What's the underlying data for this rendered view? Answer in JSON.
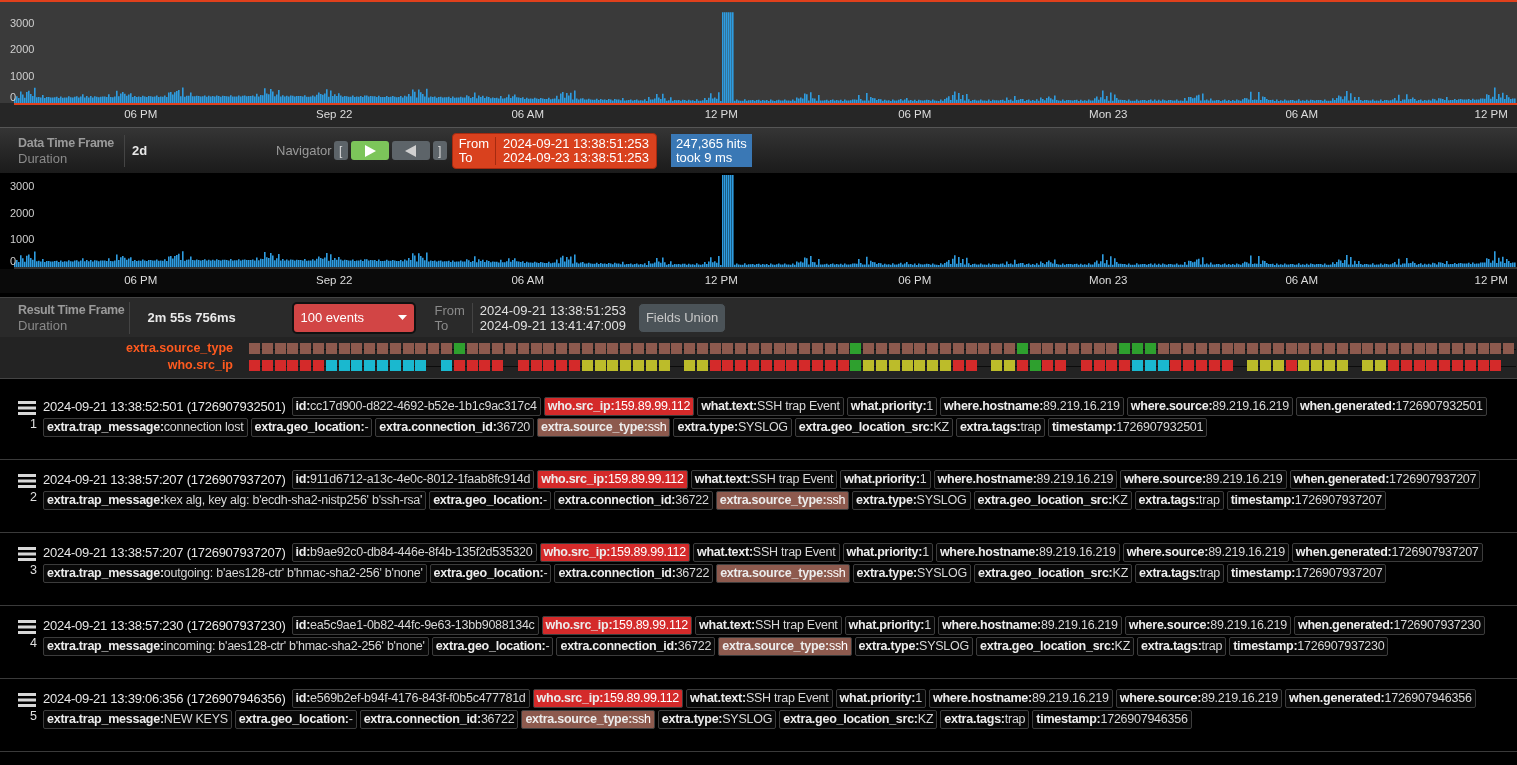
{
  "histograms": [
    {
      "kind": "overview",
      "y_labels": [
        "3000",
        "2000",
        "1000",
        "0"
      ],
      "x_labels": [
        "06 PM",
        "Sep 22",
        "06 AM",
        "12 PM",
        "06 PM",
        "Mon 23",
        "06 AM",
        "12 PM"
      ]
    },
    {
      "kind": "detail",
      "y_labels": [
        "3000",
        "2000",
        "1000",
        "0"
      ],
      "x_labels": [
        "06 PM",
        "Sep 22",
        "06 AM",
        "12 PM",
        "06 PM",
        "Mon 23",
        "06 AM",
        "12 PM"
      ]
    }
  ],
  "data_toolbar": {
    "title": "Data Time Frame",
    "subtitle": "Duration",
    "duration": "2d",
    "navigator": {
      "label": "Navigator",
      "open_bracket": "[",
      "close_bracket": "]"
    },
    "range": {
      "from_label": "From",
      "to_label": "To",
      "from": "2024-09-21 13:38:51:253",
      "to": "2024-09-23 13:38:51:253"
    },
    "hits": {
      "count": "247,365 hits",
      "took": "took 9 ms"
    }
  },
  "result_toolbar": {
    "title": "Result Time Frame",
    "subtitle": "Duration",
    "duration": "2m 55s 756ms",
    "events_dropdown": "100 events",
    "from_label": "From",
    "to_label": "To",
    "from": "2024-09-21 13:38:51:253",
    "to": "2024-09-21 13:41:47:009",
    "fields_union": "Fields Union"
  },
  "timeline": [
    {
      "label": "extra.source_type",
      "cells": [
        {
          "kind": "cell",
          "color": "#8d5a4e"
        },
        {
          "kind": "cell",
          "color": "#8d5a4e"
        },
        {
          "kind": "cell",
          "color": "#8d5a4e"
        },
        {
          "kind": "cell",
          "color": "#8d5a4e"
        },
        {
          "kind": "cell",
          "color": "#8d5a4e"
        },
        {
          "kind": "cell",
          "color": "#8d5a4e"
        },
        {
          "kind": "cell",
          "color": "#8d5a4e"
        },
        {
          "kind": "cell",
          "color": "#8d5a4e"
        },
        {
          "kind": "cell",
          "color": "#8d5a4e"
        },
        {
          "kind": "cell",
          "color": "#8d5a4e"
        },
        {
          "kind": "cell",
          "color": "#8d5a4e"
        },
        {
          "kind": "cell",
          "color": "#8d5a4e"
        },
        {
          "kind": "cell",
          "color": "#8d5a4e"
        },
        {
          "kind": "cell",
          "color": "#8d5a4e"
        },
        {
          "kind": "cell",
          "color": "#8d5a4e"
        },
        {
          "kind": "cell",
          "color": "#8d5a4e"
        },
        {
          "kind": "cell",
          "color": "#2ea02e"
        },
        {
          "kind": "cell",
          "color": "#8d5a4e"
        },
        {
          "kind": "cell",
          "color": "#8d5a4e"
        },
        {
          "kind": "cell",
          "color": "#8d5a4e"
        },
        {
          "kind": "cell",
          "color": "#8d5a4e"
        },
        {
          "kind": "cell",
          "color": "#8d5a4e"
        },
        {
          "kind": "cell",
          "color": "#8d5a4e"
        },
        {
          "kind": "cell",
          "color": "#8d5a4e"
        },
        {
          "kind": "cell",
          "color": "#8d5a4e"
        },
        {
          "kind": "cell",
          "color": "#8d5a4e"
        },
        {
          "kind": "cell",
          "color": "#8d5a4e"
        },
        {
          "kind": "cell",
          "color": "#8d5a4e"
        },
        {
          "kind": "cell",
          "color": "#8d5a4e"
        },
        {
          "kind": "cell",
          "color": "#8d5a4e"
        },
        {
          "kind": "cell",
          "color": "#8d5a4e"
        },
        {
          "kind": "cell",
          "color": "#8d5a4e"
        },
        {
          "kind": "cell",
          "color": "#8d5a4e"
        },
        {
          "kind": "cell",
          "color": "#8d5a4e"
        },
        {
          "kind": "cell",
          "color": "#8d5a4e"
        },
        {
          "kind": "cell",
          "color": "#8d5a4e"
        },
        {
          "kind": "cell",
          "color": "#8d5a4e"
        },
        {
          "kind": "cell",
          "color": "#8d5a4e"
        },
        {
          "kind": "cell",
          "color": "#8d5a4e"
        },
        {
          "kind": "cell",
          "color": "#8d5a4e"
        },
        {
          "kind": "cell",
          "color": "#8d5a4e"
        },
        {
          "kind": "cell",
          "color": "#8d5a4e"
        },
        {
          "kind": "cell",
          "color": "#8d5a4e"
        },
        {
          "kind": "cell",
          "color": "#8d5a4e"
        },
        {
          "kind": "cell",
          "color": "#8d5a4e"
        },
        {
          "kind": "cell",
          "color": "#8d5a4e"
        },
        {
          "kind": "cell",
          "color": "#8d5a4e"
        },
        {
          "kind": "cell",
          "color": "#2ea02e"
        },
        {
          "kind": "cell",
          "color": "#8d5a4e"
        },
        {
          "kind": "cell",
          "color": "#8d5a4e"
        },
        {
          "kind": "cell",
          "color": "#8d5a4e"
        },
        {
          "kind": "cell",
          "color": "#8d5a4e"
        },
        {
          "kind": "cell",
          "color": "#8d5a4e"
        },
        {
          "kind": "cell",
          "color": "#8d5a4e"
        },
        {
          "kind": "cell",
          "color": "#8d5a4e"
        },
        {
          "kind": "cell",
          "color": "#8d5a4e"
        },
        {
          "kind": "cell",
          "color": "#8d5a4e"
        },
        {
          "kind": "cell",
          "color": "#8d5a4e"
        },
        {
          "kind": "cell",
          "color": "#8d5a4e"
        },
        {
          "kind": "cell",
          "color": "#8d5a4e"
        },
        {
          "kind": "cell",
          "color": "#2ea02e"
        },
        {
          "kind": "cell",
          "color": "#8d5a4e"
        },
        {
          "kind": "cell",
          "color": "#8d5a4e"
        },
        {
          "kind": "cell",
          "color": "#8d5a4e"
        },
        {
          "kind": "cell",
          "color": "#8d5a4e"
        },
        {
          "kind": "cell",
          "color": "#8d5a4e"
        },
        {
          "kind": "cell",
          "color": "#8d5a4e"
        },
        {
          "kind": "cell",
          "color": "#8d5a4e"
        },
        {
          "kind": "cell",
          "color": "#2ea02e"
        },
        {
          "kind": "cell",
          "color": "#2ea02e"
        },
        {
          "kind": "cell",
          "color": "#2ea02e"
        },
        {
          "kind": "cell",
          "color": "#8d5a4e"
        },
        {
          "kind": "cell",
          "color": "#8d5a4e"
        },
        {
          "kind": "cell",
          "color": "#8d5a4e"
        },
        {
          "kind": "cell",
          "color": "#8d5a4e"
        },
        {
          "kind": "cell",
          "color": "#8d5a4e"
        },
        {
          "kind": "cell",
          "color": "#8d5a4e"
        },
        {
          "kind": "cell",
          "color": "#8d5a4e"
        },
        {
          "kind": "cell",
          "color": "#8d5a4e"
        },
        {
          "kind": "cell",
          "color": "#8d5a4e"
        },
        {
          "kind": "cell",
          "color": "#8d5a4e"
        },
        {
          "kind": "cell",
          "color": "#8d5a4e"
        },
        {
          "kind": "cell",
          "color": "#8d5a4e"
        },
        {
          "kind": "cell",
          "color": "#8d5a4e"
        },
        {
          "kind": "cell",
          "color": "#8d5a4e"
        },
        {
          "kind": "cell",
          "color": "#8d5a4e"
        },
        {
          "kind": "cell",
          "color": "#8d5a4e"
        },
        {
          "kind": "cell",
          "color": "#8d5a4e"
        },
        {
          "kind": "cell",
          "color": "#8d5a4e"
        },
        {
          "kind": "cell",
          "color": "#8d5a4e"
        },
        {
          "kind": "cell",
          "color": "#8d5a4e"
        },
        {
          "kind": "cell",
          "color": "#8d5a4e"
        },
        {
          "kind": "cell",
          "color": "#8d5a4e"
        },
        {
          "kind": "cell",
          "color": "#8d5a4e"
        },
        {
          "kind": "cell",
          "color": "#8d5a4e"
        },
        {
          "kind": "cell",
          "color": "#8d5a4e"
        },
        {
          "kind": "cell",
          "color": "#8d5a4e"
        },
        {
          "kind": "cell",
          "color": "#8d5a4e"
        },
        {
          "kind": "cell",
          "color": "#8d5a4e"
        }
      ]
    },
    {
      "label": "who.src_ip",
      "cells": [
        {
          "kind": "cell",
          "color": "#d42a2a"
        },
        {
          "kind": "cell",
          "color": "#d42a2a"
        },
        {
          "kind": "cell",
          "color": "#d42a2a"
        },
        {
          "kind": "cell",
          "color": "#d42a2a"
        },
        {
          "kind": "cell",
          "color": "#d42a2a"
        },
        {
          "kind": "cell",
          "color": "#d42a2a"
        },
        {
          "kind": "cell",
          "color": "#1ab8cf"
        },
        {
          "kind": "cell",
          "color": "#1ab8cf"
        },
        {
          "kind": "cell",
          "color": "#1ab8cf"
        },
        {
          "kind": "cell",
          "color": "#1ab8cf"
        },
        {
          "kind": "cell",
          "color": "#1ab8cf"
        },
        {
          "kind": "cell",
          "color": "#1ab8cf"
        },
        {
          "kind": "cell",
          "color": "#1ab8cf"
        },
        {
          "kind": "cell",
          "color": "#1ab8cf"
        },
        {
          "kind": "gap"
        },
        {
          "kind": "cell",
          "color": "#1ab8cf"
        },
        {
          "kind": "cell",
          "color": "#d42a2a"
        },
        {
          "kind": "cell",
          "color": "#d42a2a"
        },
        {
          "kind": "cell",
          "color": "#d42a2a"
        },
        {
          "kind": "cell",
          "color": "#d42a2a"
        },
        {
          "kind": "gap"
        },
        {
          "kind": "cell",
          "color": "#d42a2a"
        },
        {
          "kind": "cell",
          "color": "#d42a2a"
        },
        {
          "kind": "cell",
          "color": "#d42a2a"
        },
        {
          "kind": "cell",
          "color": "#d42a2a"
        },
        {
          "kind": "cell",
          "color": "#d42a2a"
        },
        {
          "kind": "cell",
          "color": "#bcbc2a"
        },
        {
          "kind": "cell",
          "color": "#bcbc2a"
        },
        {
          "kind": "cell",
          "color": "#bcbc2a"
        },
        {
          "kind": "cell",
          "color": "#bcbc2a"
        },
        {
          "kind": "cell",
          "color": "#bcbc2a"
        },
        {
          "kind": "cell",
          "color": "#bcbc2a"
        },
        {
          "kind": "cell",
          "color": "#bcbc2a"
        },
        {
          "kind": "gap"
        },
        {
          "kind": "cell",
          "color": "#bcbc2a"
        },
        {
          "kind": "cell",
          "color": "#bcbc2a"
        },
        {
          "kind": "cell",
          "color": "#d42a2a"
        },
        {
          "kind": "cell",
          "color": "#d42a2a"
        },
        {
          "kind": "cell",
          "color": "#d42a2a"
        },
        {
          "kind": "cell",
          "color": "#d42a2a"
        },
        {
          "kind": "cell",
          "color": "#d42a2a"
        },
        {
          "kind": "cell",
          "color": "#d42a2a"
        },
        {
          "kind": "cell",
          "color": "#d42a2a"
        },
        {
          "kind": "cell",
          "color": "#d42a2a"
        },
        {
          "kind": "cell",
          "color": "#d42a2a"
        },
        {
          "kind": "cell",
          "color": "#d42a2a"
        },
        {
          "kind": "cell",
          "color": "#d42a2a"
        },
        {
          "kind": "cell",
          "color": "#2ea02e"
        },
        {
          "kind": "cell",
          "color": "#bcbc2a"
        },
        {
          "kind": "cell",
          "color": "#bcbc2a"
        },
        {
          "kind": "cell",
          "color": "#bcbc2a"
        },
        {
          "kind": "cell",
          "color": "#bcbc2a"
        },
        {
          "kind": "cell",
          "color": "#bcbc2a"
        },
        {
          "kind": "cell",
          "color": "#bcbc2a"
        },
        {
          "kind": "cell",
          "color": "#bcbc2a"
        },
        {
          "kind": "cell",
          "color": "#d42a2a"
        },
        {
          "kind": "cell",
          "color": "#d42a2a"
        },
        {
          "kind": "gap"
        },
        {
          "kind": "cell",
          "color": "#bcbc2a"
        },
        {
          "kind": "cell",
          "color": "#bcbc2a"
        },
        {
          "kind": "cell",
          "color": "#d42a2a"
        },
        {
          "kind": "cell",
          "color": "#2ea02e"
        },
        {
          "kind": "cell",
          "color": "#d42a2a"
        },
        {
          "kind": "cell",
          "color": "#d42a2a"
        },
        {
          "kind": "gap"
        },
        {
          "kind": "cell",
          "color": "#d42a2a"
        },
        {
          "kind": "cell",
          "color": "#d42a2a"
        },
        {
          "kind": "cell",
          "color": "#d42a2a"
        },
        {
          "kind": "cell",
          "color": "#d42a2a"
        },
        {
          "kind": "cell",
          "color": "#1ab8cf"
        },
        {
          "kind": "cell",
          "color": "#1ab8cf"
        },
        {
          "kind": "cell",
          "color": "#1ab8cf"
        },
        {
          "kind": "cell",
          "color": "#d42a2a"
        },
        {
          "kind": "cell",
          "color": "#d42a2a"
        },
        {
          "kind": "cell",
          "color": "#d42a2a"
        },
        {
          "kind": "cell",
          "color": "#d42a2a"
        },
        {
          "kind": "cell",
          "color": "#d42a2a"
        },
        {
          "kind": "gap"
        },
        {
          "kind": "cell",
          "color": "#bcbc2a"
        },
        {
          "kind": "cell",
          "color": "#bcbc2a"
        },
        {
          "kind": "cell",
          "color": "#bcbc2a"
        },
        {
          "kind": "cell",
          "color": "#d42a2a"
        },
        {
          "kind": "cell",
          "color": "#bcbc2a"
        },
        {
          "kind": "cell",
          "color": "#bcbc2a"
        },
        {
          "kind": "cell",
          "color": "#bcbc2a"
        },
        {
          "kind": "cell",
          "color": "#bcbc2a"
        },
        {
          "kind": "gap"
        },
        {
          "kind": "cell",
          "color": "#bcbc2a"
        },
        {
          "kind": "cell",
          "color": "#bcbc2a"
        },
        {
          "kind": "cell",
          "color": "#d42a2a"
        },
        {
          "kind": "cell",
          "color": "#d42a2a"
        },
        {
          "kind": "cell",
          "color": "#d42a2a"
        },
        {
          "kind": "cell",
          "color": "#d42a2a"
        },
        {
          "kind": "cell",
          "color": "#d42a2a"
        },
        {
          "kind": "cell",
          "color": "#d42a2a"
        },
        {
          "kind": "cell",
          "color": "#d42a2a"
        },
        {
          "kind": "cell",
          "color": "#d42a2a"
        },
        {
          "kind": "cell",
          "color": "#d42a2a"
        },
        {
          "kind": "gap"
        }
      ]
    }
  ],
  "events": [
    {
      "number": "1",
      "header": "2024-09-21 13:38:52:501 (1726907932501)",
      "fields": [
        {
          "key": "id:",
          "value": "cc17d900-d822-4692-b52e-1b1c9ac317c4"
        },
        {
          "key": "who.src_ip:",
          "value": "159.89.99.112",
          "color": "#d42a2a"
        },
        {
          "key": "what.text:",
          "value": "SSH trap Event"
        },
        {
          "key": "what.priority:",
          "value": "1"
        },
        {
          "key": "where.hostname:",
          "value": "89.219.16.219"
        },
        {
          "key": "where.source:",
          "value": "89.219.16.219"
        },
        {
          "key": "when.generated:",
          "value": "1726907932501"
        },
        {
          "key": "extra.trap_message:",
          "value": "connection lost"
        },
        {
          "key": "extra.geo_location:",
          "value": "-"
        },
        {
          "key": "extra.connection_id:",
          "value": "36720"
        },
        {
          "key": "extra.source_type:",
          "value": "ssh",
          "color": "#8d5a4e"
        },
        {
          "key": "extra.type:",
          "value": "SYSLOG"
        },
        {
          "key": "extra.geo_location_src:",
          "value": "KZ"
        },
        {
          "key": "extra.tags:",
          "value": "trap"
        },
        {
          "key": "timestamp:",
          "value": "1726907932501"
        }
      ]
    },
    {
      "number": "2",
      "header": "2024-09-21 13:38:57:207 (1726907937207)",
      "fields": [
        {
          "key": "id:",
          "value": "911d6712-a13c-4e0c-8012-1faab8fc914d"
        },
        {
          "key": "who.src_ip:",
          "value": "159.89.99.112",
          "color": "#d42a2a"
        },
        {
          "key": "what.text:",
          "value": "SSH trap Event"
        },
        {
          "key": "what.priority:",
          "value": "1"
        },
        {
          "key": "where.hostname:",
          "value": "89.219.16.219"
        },
        {
          "key": "where.source:",
          "value": "89.219.16.219"
        },
        {
          "key": "when.generated:",
          "value": "1726907937207"
        },
        {
          "key": "extra.trap_message:",
          "value": "kex alg, key alg: b'ecdh-sha2-nistp256' b'ssh-rsa'"
        },
        {
          "key": "extra.geo_location:",
          "value": "-"
        },
        {
          "key": "extra.connection_id:",
          "value": "36722"
        },
        {
          "key": "extra.source_type:",
          "value": "ssh",
          "color": "#8d5a4e"
        },
        {
          "key": "extra.type:",
          "value": "SYSLOG"
        },
        {
          "key": "extra.geo_location_src:",
          "value": "KZ"
        },
        {
          "key": "extra.tags:",
          "value": "trap"
        },
        {
          "key": "timestamp:",
          "value": "1726907937207"
        }
      ]
    },
    {
      "number": "3",
      "header": "2024-09-21 13:38:57:207 (1726907937207)",
      "fields": [
        {
          "key": "id:",
          "value": "b9ae92c0-db84-446e-8f4b-135f2d535320"
        },
        {
          "key": "who.src_ip:",
          "value": "159.89.99.112",
          "color": "#d42a2a"
        },
        {
          "key": "what.text:",
          "value": "SSH trap Event"
        },
        {
          "key": "what.priority:",
          "value": "1"
        },
        {
          "key": "where.hostname:",
          "value": "89.219.16.219"
        },
        {
          "key": "where.source:",
          "value": "89.219.16.219"
        },
        {
          "key": "when.generated:",
          "value": "1726907937207"
        },
        {
          "key": "extra.trap_message:",
          "value": "outgoing: b'aes128-ctr' b'hmac-sha2-256' b'none'"
        },
        {
          "key": "extra.geo_location:",
          "value": "-"
        },
        {
          "key": "extra.connection_id:",
          "value": "36722"
        },
        {
          "key": "extra.source_type:",
          "value": "ssh",
          "color": "#8d5a4e"
        },
        {
          "key": "extra.type:",
          "value": "SYSLOG"
        },
        {
          "key": "extra.geo_location_src:",
          "value": "KZ"
        },
        {
          "key": "extra.tags:",
          "value": "trap"
        },
        {
          "key": "timestamp:",
          "value": "1726907937207"
        }
      ]
    },
    {
      "number": "4",
      "header": "2024-09-21 13:38:57:230 (1726907937230)",
      "fields": [
        {
          "key": "id:",
          "value": "ea5c9ae1-0b82-44fc-9e63-13bb9088134c"
        },
        {
          "key": "who.src_ip:",
          "value": "159.89.99.112",
          "color": "#d42a2a"
        },
        {
          "key": "what.text:",
          "value": "SSH trap Event"
        },
        {
          "key": "what.priority:",
          "value": "1"
        },
        {
          "key": "where.hostname:",
          "value": "89.219.16.219"
        },
        {
          "key": "where.source:",
          "value": "89.219.16.219"
        },
        {
          "key": "when.generated:",
          "value": "1726907937230"
        },
        {
          "key": "extra.trap_message:",
          "value": "incoming: b'aes128-ctr' b'hmac-sha2-256' b'none'"
        },
        {
          "key": "extra.geo_location:",
          "value": "-"
        },
        {
          "key": "extra.connection_id:",
          "value": "36722"
        },
        {
          "key": "extra.source_type:",
          "value": "ssh",
          "color": "#8d5a4e"
        },
        {
          "key": "extra.type:",
          "value": "SYSLOG"
        },
        {
          "key": "extra.geo_location_src:",
          "value": "KZ"
        },
        {
          "key": "extra.tags:",
          "value": "trap"
        },
        {
          "key": "timestamp:",
          "value": "1726907937230"
        }
      ]
    },
    {
      "number": "5",
      "header": "2024-09-21 13:39:06:356 (1726907946356)",
      "fields": [
        {
          "key": "id:",
          "value": "e569b2ef-b94f-4176-843f-f0b5c477781d"
        },
        {
          "key": "who.src_ip:",
          "value": "159.89.99.112",
          "color": "#d42a2a"
        },
        {
          "key": "what.text:",
          "value": "SSH trap Event"
        },
        {
          "key": "what.priority:",
          "value": "1"
        },
        {
          "key": "where.hostname:",
          "value": "89.219.16.219"
        },
        {
          "key": "where.source:",
          "value": "89.219.16.219"
        },
        {
          "key": "when.generated:",
          "value": "1726907946356"
        },
        {
          "key": "extra.trap_message:",
          "value": "NEW KEYS"
        },
        {
          "key": "extra.geo_location:",
          "value": "-"
        },
        {
          "key": "extra.connection_id:",
          "value": "36722"
        },
        {
          "key": "extra.source_type:",
          "value": "ssh",
          "color": "#8d5a4e"
        },
        {
          "key": "extra.type:",
          "value": "SYSLOG"
        },
        {
          "key": "extra.geo_location_src:",
          "value": "KZ"
        },
        {
          "key": "extra.tags:",
          "value": "trap"
        },
        {
          "key": "timestamp:",
          "value": "1726907946356"
        }
      ]
    }
  ]
}
